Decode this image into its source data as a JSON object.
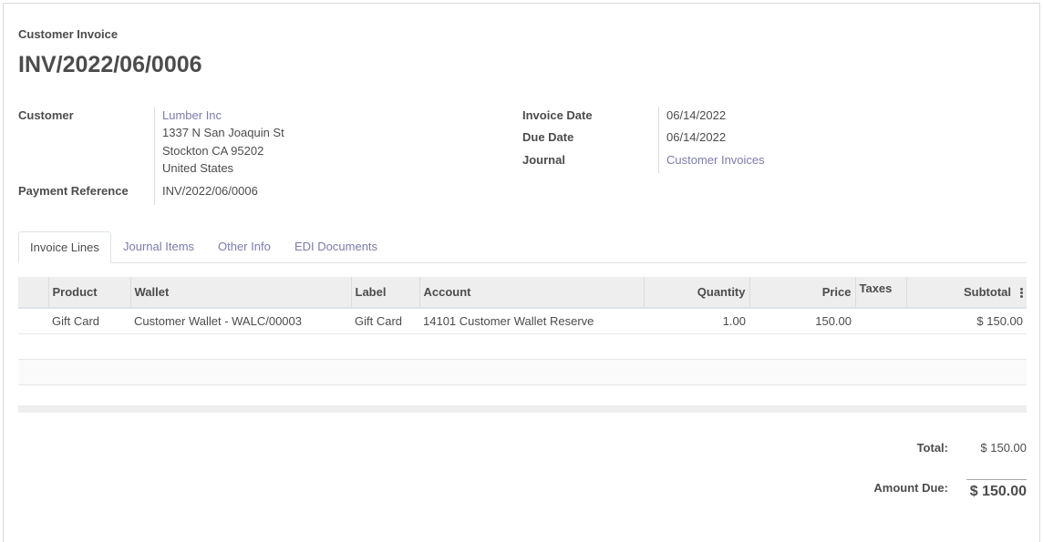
{
  "invoice": {
    "type_label": "Customer Invoice",
    "number": "INV/2022/06/0006"
  },
  "fields": {
    "customer_label": "Customer",
    "customer_name": "Lumber Inc",
    "address_line1": "1337 N San Joaquin St",
    "address_line2": "Stockton CA 95202",
    "address_line3": "United States",
    "payment_ref_label": "Payment Reference",
    "payment_ref": "INV/2022/06/0006",
    "invoice_date_label": "Invoice Date",
    "invoice_date": "06/14/2022",
    "due_date_label": "Due Date",
    "due_date": "06/14/2022",
    "journal_label": "Journal",
    "journal": "Customer Invoices"
  },
  "tabs": [
    {
      "label": "Invoice Lines",
      "active": true
    },
    {
      "label": "Journal Items",
      "active": false
    },
    {
      "label": "Other Info",
      "active": false
    },
    {
      "label": "EDI Documents",
      "active": false
    }
  ],
  "table": {
    "headers": [
      "Product",
      "Wallet",
      "Label",
      "Account",
      "Quantity",
      "Price",
      "Taxes",
      "Subtotal"
    ],
    "rows": [
      {
        "product": "Gift Card",
        "wallet": "Customer Wallet - WALC/00003",
        "label": "Gift Card",
        "account": "14101 Customer Wallet Reserve",
        "quantity": "1.00",
        "price": "150.00",
        "taxes": "",
        "subtotal": "$ 150.00"
      }
    ]
  },
  "totals": {
    "total_label": "Total:",
    "total_value": "$ 150.00",
    "amount_due_label": "Amount Due:",
    "amount_due_value": "$ 150.00"
  },
  "icons": {
    "column_options": "kebab-vertical-icon"
  },
  "colors": {
    "link": "#7c7bad",
    "text": "#4c4c4c",
    "header_bg": "#eeeeee"
  }
}
